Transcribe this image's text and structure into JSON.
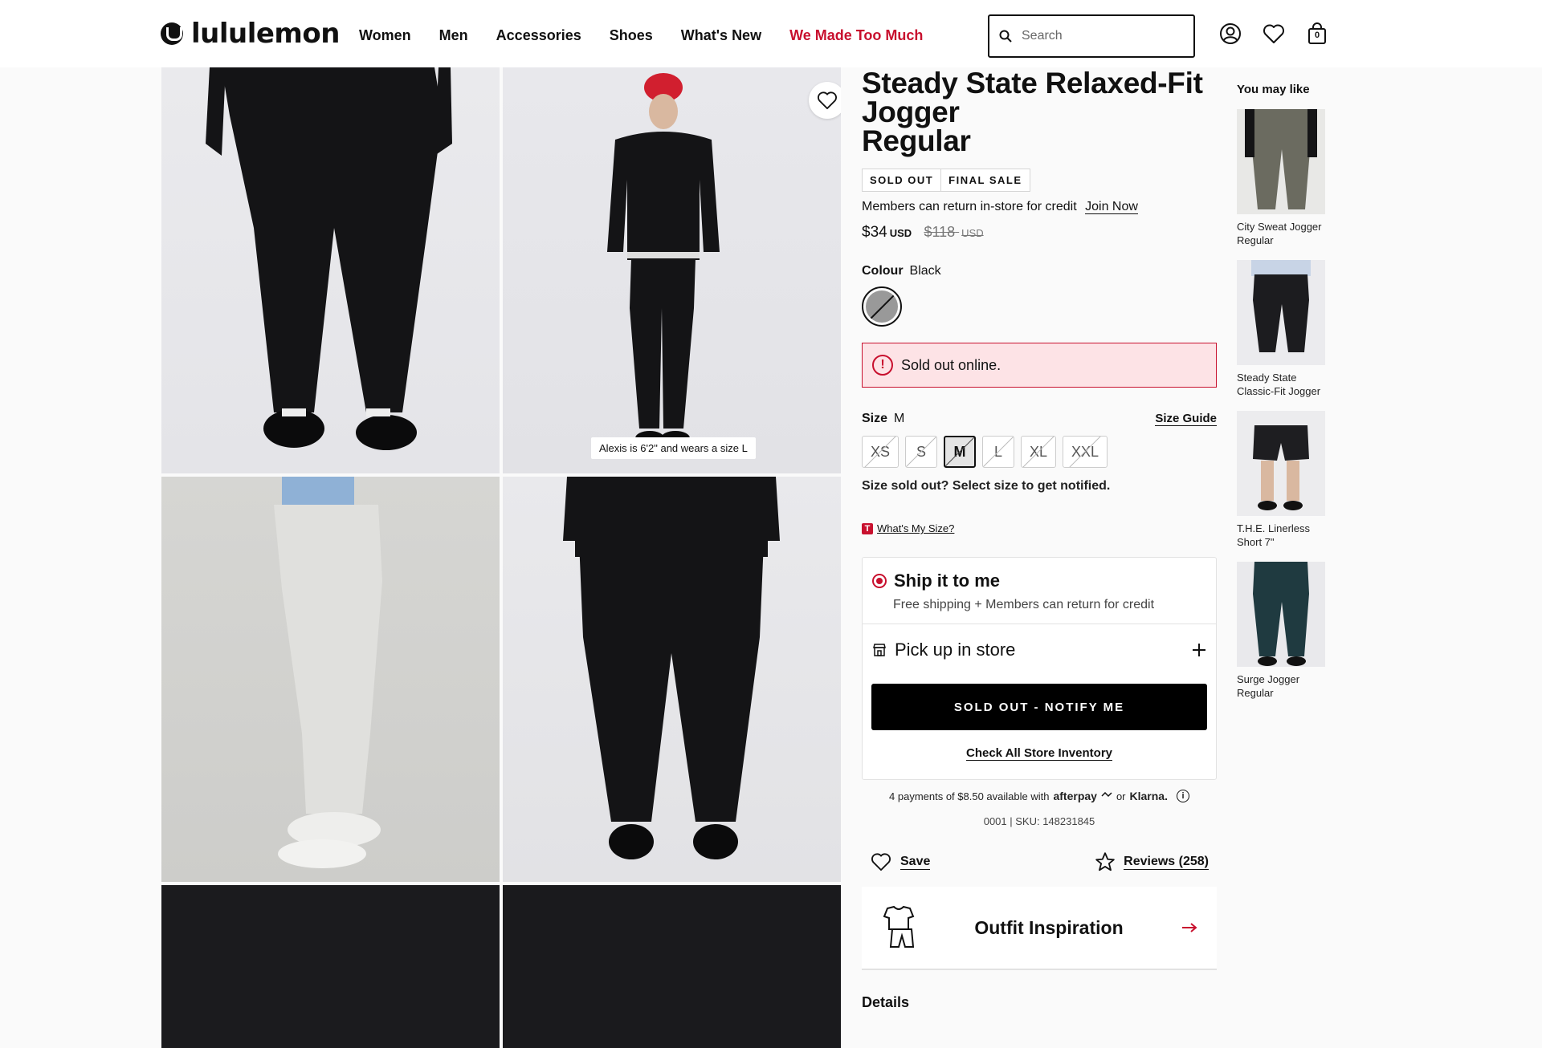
{
  "brand": {
    "name": "lululemon"
  },
  "nav": [
    {
      "label": "Women"
    },
    {
      "label": "Men"
    },
    {
      "label": "Accessories"
    },
    {
      "label": "Shoes"
    },
    {
      "label": "What's New"
    },
    {
      "label": "We Made Too Much"
    }
  ],
  "search": {
    "placeholder": "Search"
  },
  "header_icons": [
    "account-icon",
    "heart-icon",
    "bag-icon"
  ],
  "cart": {
    "count": "0"
  },
  "gallery": {
    "model_note": "Alexis is 6'2\" and wears a size L"
  },
  "product": {
    "title_line1": "Steady State Relaxed-Fit",
    "title_line2": "Jogger",
    "title_line3": "Regular",
    "badges": [
      "SOLD OUT",
      "FINAL SALE"
    ],
    "member_text": "Members can return in-store for credit",
    "join_label": "Join Now",
    "price": "$34",
    "price_currency": "USD",
    "orig_price": "$118",
    "orig_currency": "USD",
    "colour_label": "Colour",
    "colour_value": "Black",
    "alert": "Sold out online.",
    "size_label": "Size",
    "size_value": "M",
    "size_guide": "Size Guide",
    "sizes": [
      "XS",
      "S",
      "M",
      "L",
      "XL",
      "XXL"
    ],
    "selected_size": "M",
    "size_sold_note": "Size sold out? Select size to get notified.",
    "whats_my_size": "What's My Size?",
    "ship_title": "Ship it to me",
    "ship_sub": "Free shipping + Members can return for credit",
    "pickup_title": "Pick up in store",
    "notify_button": "SOLD OUT - NOTIFY ME",
    "check_inventory": "Check All Store Inventory",
    "pay_text": "4 payments of $8.50 available with",
    "pay_afterpay": "afterpay",
    "pay_or": "or",
    "pay_klarna": "Klarna.",
    "sku": "0001 | SKU: 148231845",
    "save_label": "Save",
    "reviews_label": "Reviews (258)",
    "outfit_title": "Outfit Inspiration",
    "details_title": "Details"
  },
  "you_may_like": {
    "title": "You may like",
    "items": [
      {
        "name": "City Sweat Jogger Regular",
        "color": "#6b6b60"
      },
      {
        "name": "Steady State Classic-Fit Jogger",
        "color": "#1c1c1f"
      },
      {
        "name": "T.H.E. Linerless Short 7\"",
        "color": "#1e1e21"
      },
      {
        "name": "Surge Jogger Regular",
        "color": "#1f3a40"
      }
    ]
  },
  "colors": {
    "accent_red": "#c8102e",
    "alert_bg": "#fde3e6"
  }
}
